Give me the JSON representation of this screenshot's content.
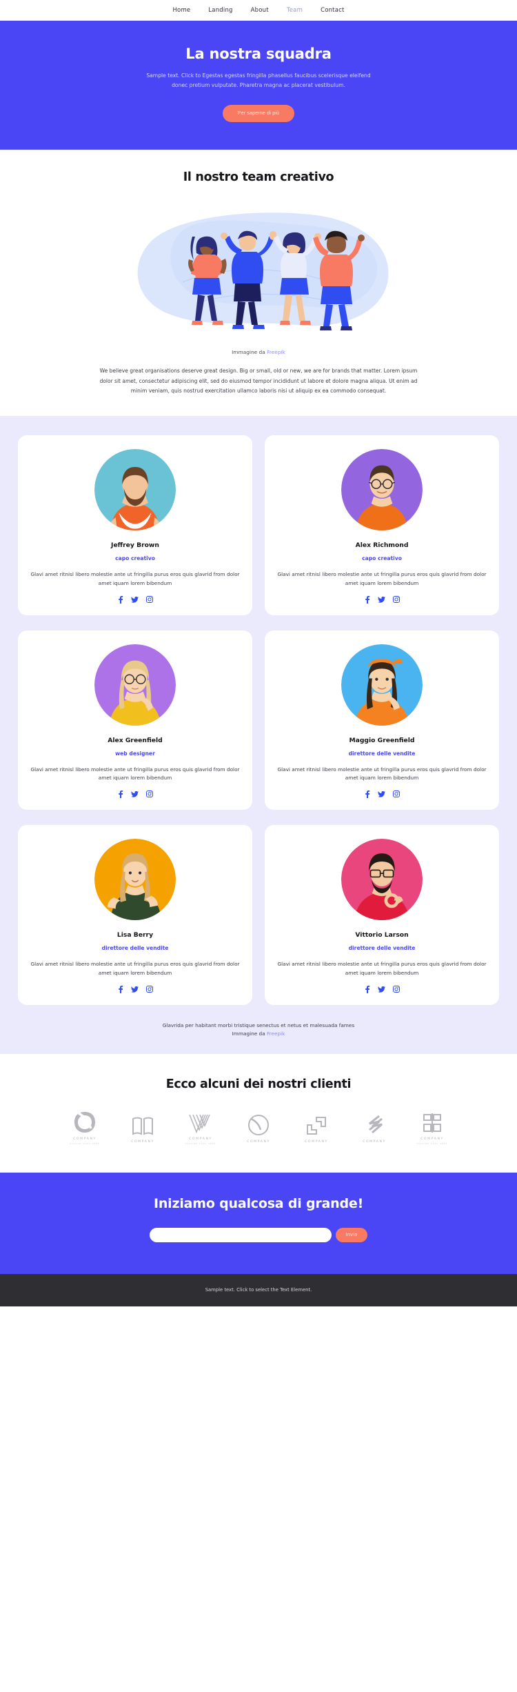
{
  "nav": {
    "items": [
      {
        "label": "Home",
        "active": false
      },
      {
        "label": "Landing",
        "active": false
      },
      {
        "label": "About",
        "active": false
      },
      {
        "label": "Team",
        "active": true
      },
      {
        "label": "Contact",
        "active": false
      }
    ]
  },
  "hero": {
    "title": "La nostra squadra",
    "subtitle": "Sample text. Click to Egestas egestas fringilla phasellus faucibus scelerisque eleifend donec pretium vulputate. Pharetra magna ac placerat vestibulum.",
    "button_label": "Per saperne di più",
    "bg_color": "#4b46f5",
    "button_color": "#f97a62"
  },
  "creative": {
    "title": "Il nostro team creativo",
    "credit_prefix": "Immagine da",
    "credit_link": "Freepik",
    "body": "We believe great organisations deserve great design. Big or small, old or new, we are for brands that matter. Lorem ipsum dolor sit amet, consectetur adipiscing elit, sed do eiusmod tempor incididunt ut labore et dolore magna aliqua. Ut enim ad minim veniam, quis nostrud exercitation ullamco laboris nisi ut aliquip ex ea commodo consequat."
  },
  "team": {
    "bg_color": "#ebeafd",
    "bio": "Glavi amet ritnisl libero molestie ante ut fringilla purus eros quis glavrid from dolor amet iquam lorem bibendum",
    "social_icons": [
      "facebook-icon",
      "twitter-icon",
      "instagram-icon"
    ],
    "members": [
      {
        "name": "Jeffrey Brown",
        "role": "capo creativo",
        "bg": "#69c3d4",
        "shirt": "#f0642a",
        "hair": "#6b4226",
        "skin": "#f3c39a",
        "beard": true,
        "glasses": false
      },
      {
        "name": "Alex Richmond",
        "role": "capo creativo",
        "bg": "#9366e0",
        "shirt": "#f07019",
        "hair": "#4a3520",
        "skin": "#f5cfa8",
        "beard": false,
        "glasses": true
      },
      {
        "name": "Alex Greenfield",
        "role": "web designer",
        "bg": "#ad72e8",
        "shirt": "#f2c01e",
        "hair": "#e8c98a",
        "skin": "#f7d4ae",
        "beard": false,
        "glasses": true
      },
      {
        "name": "Maggio Greenfield",
        "role": "direttore delle vendite",
        "bg": "#49b4ef",
        "shirt": "#f58220",
        "hair": "#3a2617",
        "skin": "#f6d3ab",
        "beard": false,
        "glasses": false
      },
      {
        "name": "Lisa Berry",
        "role": "direttore delle vendite",
        "bg": "#f5a100",
        "shirt": "#2f4a2c",
        "hair": "#d9ae6d",
        "skin": "#f7d4ae",
        "beard": false,
        "glasses": false
      },
      {
        "name": "Vittorio Larson",
        "role": "direttore delle vendite",
        "bg": "#e8467c",
        "shirt": "#e11b3c",
        "hair": "#231a14",
        "skin": "#f2c9a0",
        "beard": true,
        "glasses": true
      }
    ],
    "footnote_line1": "Glavrida per habitant morbi tristique senectus et netus et malesuada fames",
    "footnote_prefix": "Immagine da",
    "footnote_link": "Freepik"
  },
  "clients": {
    "title": "Ecco alcuni dei nostri clienti",
    "logos": [
      {
        "icon": "company-ring-icon",
        "name": "COMPANY",
        "tagline": "SLOGAN GOES HERE"
      },
      {
        "icon": "company-book-icon",
        "name": "COMPANY",
        "tagline": ""
      },
      {
        "icon": "company-chevron-icon",
        "name": "COMPANY",
        "tagline": "TAGLINE GOES HERE"
      },
      {
        "icon": "company-circle-icon",
        "name": "COMPANY",
        "tagline": ""
      },
      {
        "icon": "company-bracket-icon",
        "name": "COMPANY",
        "tagline": ""
      },
      {
        "icon": "company-slash-icon",
        "name": "COMPANY",
        "tagline": ""
      },
      {
        "icon": "company-square-icon",
        "name": "COMPANY",
        "tagline": "TAGLINE GOES HERE"
      }
    ]
  },
  "cta": {
    "title": "Iniziamo qualcosa di grande!",
    "input_value": "",
    "input_placeholder": "",
    "submit_label": "Invia"
  },
  "footer": {
    "text": "Sample text. Click to select the Text Element."
  }
}
